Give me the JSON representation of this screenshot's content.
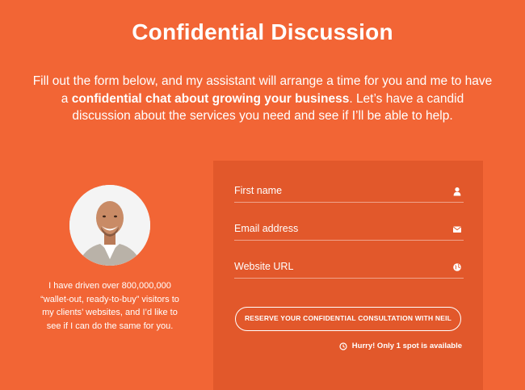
{
  "header": {
    "title": "Confidential Discussion",
    "intro_part1": "Fill out the form below, and my assistant will arrange a time for you and me to have a ",
    "intro_bold": "confidential chat about growing your business",
    "intro_part2": ". Let’s have a candid discussion about the services you need and see if I’ll be able to help."
  },
  "profile": {
    "bio": "I have driven over 800,000,000 “wallet-out, ready-to-buy” visitors to my clients’ websites, and I’d like to see if I can do the same for you."
  },
  "form": {
    "fields": [
      {
        "label": "First name",
        "icon": "user-icon"
      },
      {
        "label": "Email address",
        "icon": "envelope-icon"
      },
      {
        "label": "Website URL",
        "icon": "globe-icon"
      }
    ],
    "submit_label": "RESERVE YOUR CONFIDENTIAL CONSULTATION WITH NEIL",
    "urgency_text": "Hurry! Only 1 spot is available",
    "urgency_icon": "clock-icon"
  },
  "colors": {
    "background": "#f26535",
    "panel": "#e2582b",
    "text": "#ffffff"
  }
}
